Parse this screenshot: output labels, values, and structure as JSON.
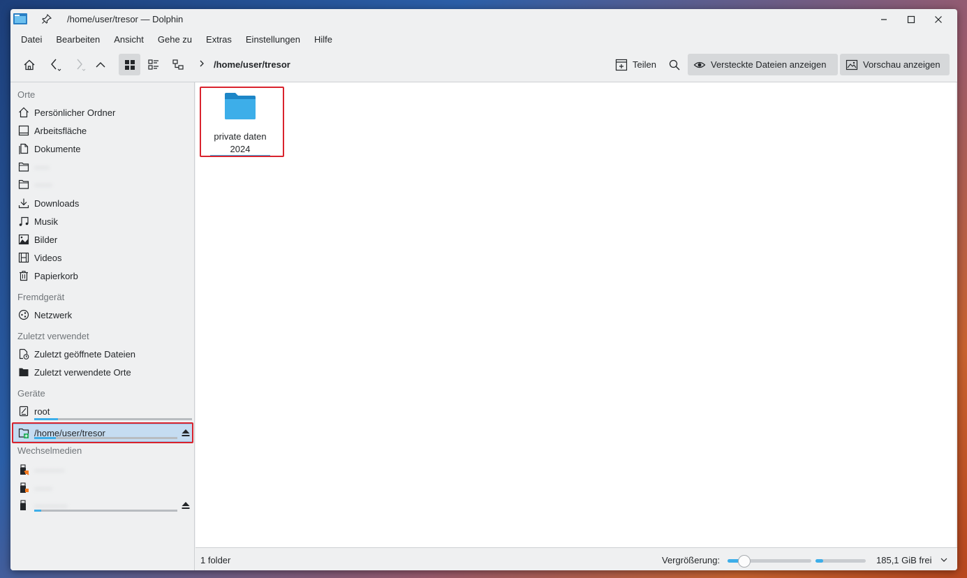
{
  "window": {
    "title": "/home/user/tresor — Dolphin"
  },
  "menubar": {
    "items": [
      "Datei",
      "Bearbeiten",
      "Ansicht",
      "Gehe zu",
      "Extras",
      "Einstellungen",
      "Hilfe"
    ]
  },
  "toolbar": {
    "path": "/home/user/tresor",
    "share_label": "Teilen",
    "hidden_files_label": "Versteckte Dateien anzeigen",
    "preview_label": "Vorschau anzeigen"
  },
  "sidebar": {
    "sections": {
      "places": "Orte",
      "remote": "Fremdgerät",
      "recent": "Zuletzt verwendet",
      "devices": "Geräte",
      "removable": "Wechselmedien"
    },
    "places": [
      {
        "label": "Persönlicher Ordner",
        "icon": "home-icon"
      },
      {
        "label": "Arbeitsfläche",
        "icon": "desktop-icon"
      },
      {
        "label": "Dokumente",
        "icon": "documents-icon"
      },
      {
        "label": "·····",
        "icon": "folder-icon"
      },
      {
        "label": "······",
        "icon": "folder-icon"
      },
      {
        "label": "Downloads",
        "icon": "download-icon"
      },
      {
        "label": "Musik",
        "icon": "music-icon"
      },
      {
        "label": "Bilder",
        "icon": "pictures-icon"
      },
      {
        "label": "Videos",
        "icon": "video-icon"
      },
      {
        "label": "Papierkorb",
        "icon": "trash-icon"
      }
    ],
    "remote": [
      {
        "label": "Netzwerk",
        "icon": "network-icon"
      }
    ],
    "recent": [
      {
        "label": "Zuletzt geöffnete Dateien",
        "icon": "recent-files-icon"
      },
      {
        "label": "Zuletzt verwendete Orte",
        "icon": "recent-places-icon"
      }
    ],
    "devices": [
      {
        "label": "root",
        "icon": "drive-icon",
        "usage": 0.2
      },
      {
        "label": "/home/user/tresor",
        "icon": "encrypted-folder-icon",
        "usage": 0.15
      }
    ],
    "removable": [
      {
        "label": "··········",
        "icon": "usb-icon"
      },
      {
        "label": "······",
        "icon": "usb-icon"
      },
      {
        "label": "···········",
        "icon": "usb-icon",
        "usage": 0.05
      }
    ]
  },
  "content": {
    "items": [
      {
        "name_line1": "private daten",
        "name_line2": "2024",
        "icon": "folder-icon"
      }
    ]
  },
  "statusbar": {
    "summary": "1 folder",
    "zoom_label": "Vergrößerung:",
    "zoom_value": 0.2,
    "free_space_fill": 0.15,
    "free_space": "185,1 GiB frei"
  },
  "colors": {
    "accent": "#3daee9",
    "highlight_box": "#d9232d",
    "selection": "#c5dcf1",
    "folder_blue": "#3daee9"
  }
}
